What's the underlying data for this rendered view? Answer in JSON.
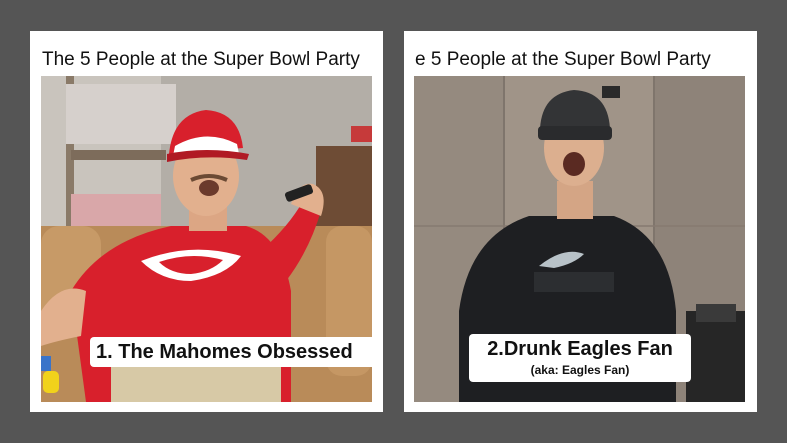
{
  "cards": [
    {
      "title": "The 5 People at the Super Bowl Party",
      "caption": "1. The Mahomes Obsessed"
    },
    {
      "title": "e 5 People at the Super Bowl Party",
      "caption": "2.Drunk Eagles Fan",
      "subcaption": "(aka: Eagles Fan)"
    }
  ],
  "colors": {
    "background": "#555555",
    "card": "#ffffff",
    "chiefs_red": "#d8202c",
    "eagles_black": "#1e1f22"
  }
}
